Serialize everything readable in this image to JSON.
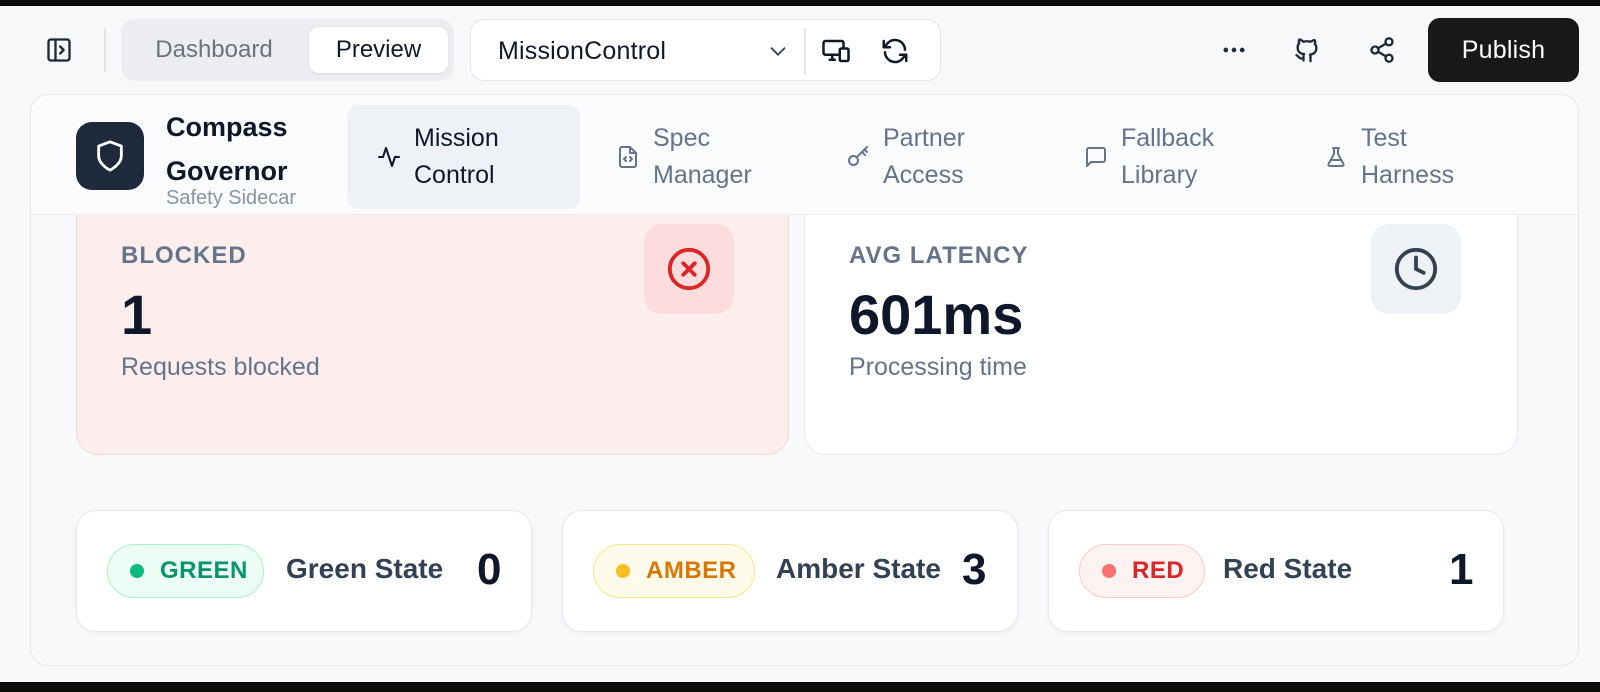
{
  "toolbar": {
    "tabs": {
      "dashboard": "Dashboard",
      "preview": "Preview"
    },
    "project_selector": {
      "value": "MissionControl"
    },
    "publish_label": "Publish"
  },
  "app": {
    "brand": {
      "name": "Compass Governor",
      "subtitle": "Safety Sidecar"
    },
    "nav": [
      {
        "label": "Mission Control",
        "icon": "activity-icon",
        "active": true
      },
      {
        "label": "Spec Manager",
        "icon": "file-code-icon",
        "active": false
      },
      {
        "label": "Partner Access",
        "icon": "key-icon",
        "active": false
      },
      {
        "label": "Fallback Library",
        "icon": "message-square-icon",
        "active": false
      },
      {
        "label": "Test Harness",
        "icon": "flask-icon",
        "active": false
      }
    ],
    "stats": {
      "blocked": {
        "label": "BLOCKED",
        "value": "1",
        "subtitle": "Requests blocked",
        "icon": "x-circle-icon"
      },
      "latency": {
        "label": "AVG LATENCY",
        "value": "601ms",
        "subtitle": "Processing time",
        "icon": "clock-icon"
      }
    },
    "states": [
      {
        "badge": "GREEN",
        "name": "Green State",
        "count": "0",
        "color": "#10b981",
        "bg": "#ecfdf5",
        "border": "#a7f3d0",
        "text": "#059669"
      },
      {
        "badge": "AMBER",
        "name": "Amber State",
        "count": "3",
        "color": "#fbbf24",
        "bg": "#fffbeb",
        "border": "#fde68a",
        "text": "#d97706"
      },
      {
        "badge": "RED",
        "name": "Red State",
        "count": "1",
        "color": "#f87171",
        "bg": "#fef2f2",
        "border": "#fecaca",
        "text": "#dc2626"
      }
    ]
  }
}
